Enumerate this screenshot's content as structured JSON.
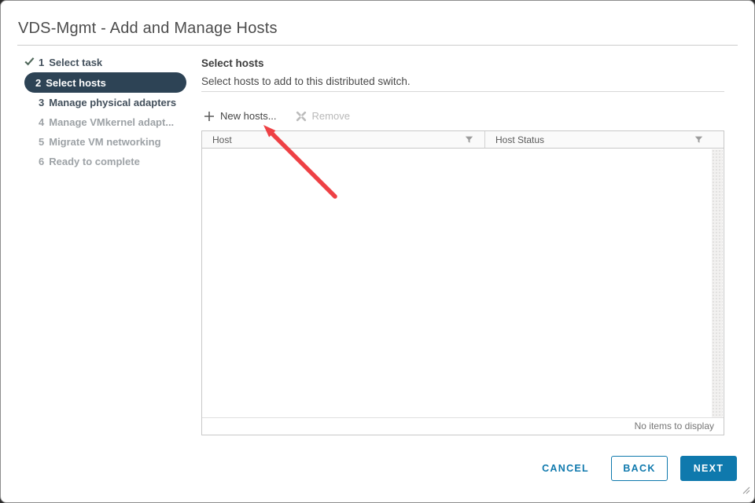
{
  "dialog": {
    "title": "VDS-Mgmt - Add and Manage Hosts"
  },
  "wizard": {
    "steps": [
      {
        "number": "1",
        "label": "Select task",
        "state": "completed"
      },
      {
        "number": "2",
        "label": "Select hosts",
        "state": "current"
      },
      {
        "number": "3",
        "label": "Manage physical adapters",
        "state": "available"
      },
      {
        "number": "4",
        "label": "Manage VMkernel adapt...",
        "state": "upcoming"
      },
      {
        "number": "5",
        "label": "Migrate VM networking",
        "state": "upcoming"
      },
      {
        "number": "6",
        "label": "Ready to complete",
        "state": "upcoming"
      }
    ]
  },
  "main": {
    "heading": "Select hosts",
    "description": "Select hosts to add to this distributed switch.",
    "toolbar": {
      "new_hosts_label": "New hosts...",
      "remove_label": "Remove"
    },
    "table": {
      "columns": [
        {
          "label": "Host"
        },
        {
          "label": "Host Status"
        }
      ],
      "rows": [],
      "empty_message": "No items to display"
    }
  },
  "footer": {
    "cancel_label": "CANCEL",
    "back_label": "BACK",
    "next_label": "NEXT"
  },
  "icons": {
    "completed_step": "check-icon",
    "new_hosts": "plus-icon",
    "remove": "x-icon",
    "column_filter": "funnel-icon",
    "window_resize": "diagonal-grip-icon",
    "annotation": "red-arrow pointing at New hosts button"
  },
  "colors": {
    "accent_blue": "#0f79ad",
    "active_step_bg": "#2d4355",
    "completed_check": "#51695c",
    "arrow_red": "#ee4145"
  }
}
